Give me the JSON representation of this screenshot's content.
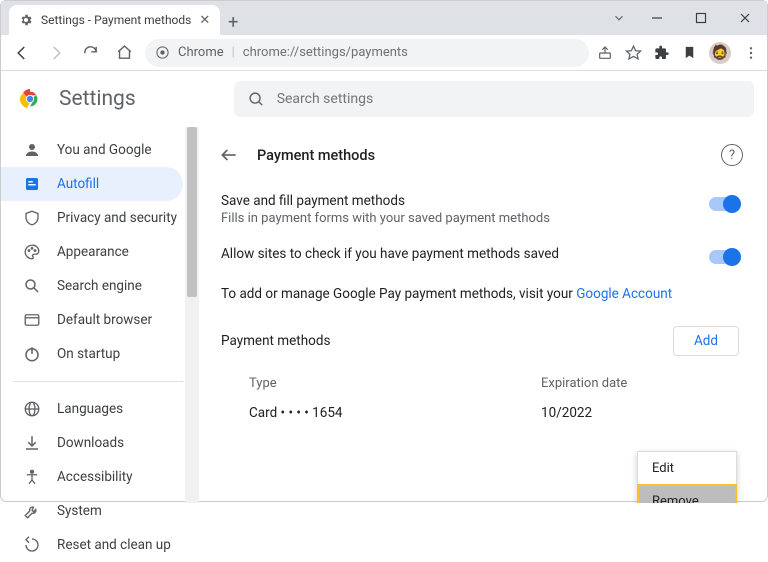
{
  "tab": {
    "title": "Settings - Payment methods"
  },
  "omnibox": {
    "chip": "Chrome",
    "url": "chrome://settings/payments"
  },
  "app": {
    "title": "Settings"
  },
  "search": {
    "placeholder": "Search settings"
  },
  "sidebar": {
    "items": [
      {
        "label": "You and Google"
      },
      {
        "label": "Autofill"
      },
      {
        "label": "Privacy and security"
      },
      {
        "label": "Appearance"
      },
      {
        "label": "Search engine"
      },
      {
        "label": "Default browser"
      },
      {
        "label": "On startup"
      }
    ],
    "advanced": [
      {
        "label": "Languages"
      },
      {
        "label": "Downloads"
      },
      {
        "label": "Accessibility"
      },
      {
        "label": "System"
      },
      {
        "label": "Reset and clean up"
      }
    ]
  },
  "page": {
    "title": "Payment methods",
    "saveFill": {
      "title": "Save and fill payment methods",
      "sub": "Fills in payment forms with your saved payment methods"
    },
    "allowCheck": {
      "title": "Allow sites to check if you have payment methods saved"
    },
    "manage": {
      "pre": "To add or manage Google Pay payment methods, visit your ",
      "link": "Google Account"
    },
    "pm": {
      "heading": "Payment methods",
      "add": "Add",
      "colType": "Type",
      "colExp": "Expiration date",
      "rowType": "Card • • • • 1654",
      "rowExp": "10/2022"
    },
    "ctx": {
      "edit": "Edit",
      "remove": "Remove"
    }
  }
}
